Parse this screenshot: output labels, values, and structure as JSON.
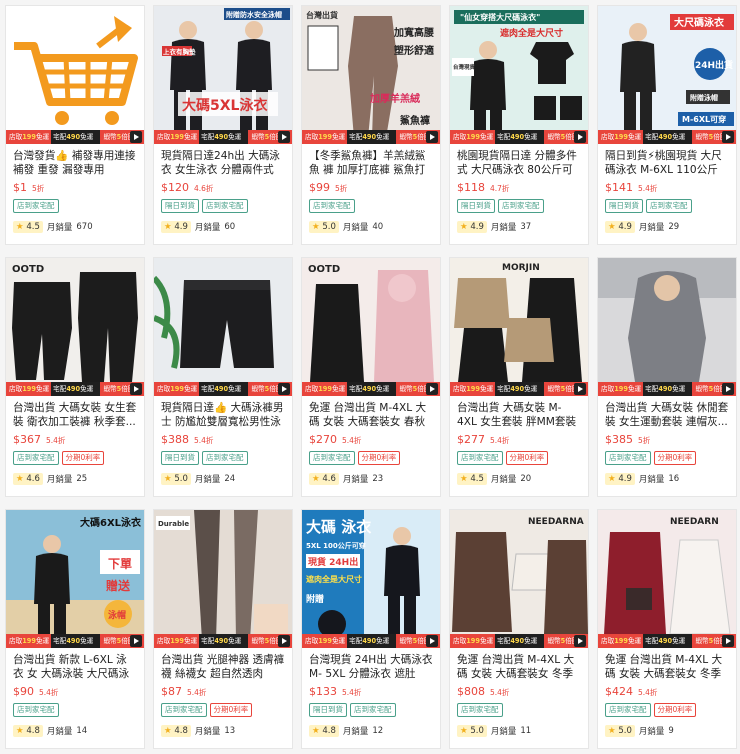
{
  "promo": {
    "pickup": "店取",
    "pickup_amt": "199",
    "ship": "免運",
    "home": "宅配",
    "home_amt": "490",
    "home_ship": "免運",
    "ad": "蝦幣",
    "back": "5",
    "back_unit": "倍回饋"
  },
  "products": [
    {
      "title": "台灣發貨👍 補發專用連接 補發 重發 漏發專用",
      "price": "$1",
      "disc": "5折",
      "tags": [
        "店到家宅配"
      ],
      "rating": "4.5",
      "sold_label": "月銷量",
      "sold": "670",
      "theme": "cart",
      "img_texts": []
    },
    {
      "title": "現貨隔日達24h出 大碼泳衣 女生泳衣 分體兩件式 泳...",
      "price": "$120",
      "disc": "4.6折",
      "tags": [
        "隔日到貨",
        "店到家宅配"
      ],
      "rating": "4.9",
      "sold_label": "月銷量",
      "sold": "60",
      "theme": "swim",
      "img_texts": [
        "附贈防水安全泳帽",
        "上衣有胸墊",
        "大碼5XL泳衣"
      ]
    },
    {
      "title": "【冬季鯊魚褲】羊羔絨鯊魚 褲 加厚打底褲 鯊魚打底...",
      "price": "$99",
      "disc": "5折",
      "tags": [
        "店到家宅配"
      ],
      "rating": "5.0",
      "sold_label": "月銷量",
      "sold": "40",
      "theme": "legging",
      "img_texts": [
        "台灣出貨",
        "加寬高腰",
        "塑形舒適",
        "加厚羊羔絨",
        "鯊魚褲"
      ]
    },
    {
      "title": "桃園現貨隔日達 分體多件式 大尺碼泳衣 80公斤可穿...",
      "price": "$118",
      "disc": "4.7折",
      "tags": [
        "隔日到貨",
        "店到家宅配"
      ],
      "rating": "4.9",
      "sold_label": "月銷量",
      "sold": "37",
      "theme": "swim2",
      "img_texts": [
        "\"仙女穿搭大尺碼泳衣\"",
        "遮肉全是大尺寸",
        "台灣現貨"
      ]
    },
    {
      "title": "隔日到貨⚡桃園現貨 大尺 碼泳衣 M-6XL 110公斤可...",
      "price": "$141",
      "disc": "5.4折",
      "tags": [
        "隔日到貨",
        "店到家宅配"
      ],
      "rating": "4.9",
      "sold_label": "月銷量",
      "sold": "29",
      "theme": "swim3",
      "img_texts": [
        "大尺碼泳衣",
        "24H出貨",
        "附贈泳帽",
        "M-6XL可穿"
      ]
    },
    {
      "title": "台灣出貨 大碼女裝 女生套 裝 衛衣加工裝褲 秋季套...",
      "price": "$367",
      "disc": "5.4折",
      "tags": [
        "店到家宅配",
        "分期0利率"
      ],
      "rating": "4.6",
      "sold_label": "月銷量",
      "sold": "25",
      "theme": "black2",
      "img_texts": [
        "OOTD"
      ]
    },
    {
      "title": "現貨隔日達👍 大碼泳褲男士 防尷尬雙層寬松男性泳褲 ...",
      "price": "$388",
      "disc": "5.4折",
      "tags": [
        "隔日到貨",
        "店到家宅配"
      ],
      "rating": "5.0",
      "sold_label": "月銷量",
      "sold": "24",
      "theme": "shorts",
      "img_texts": []
    },
    {
      "title": "免運 台灣出貨 M-4XL 大碼 女裝 大碼套裝女 春秋季...",
      "price": "$270",
      "disc": "5.4折",
      "tags": [
        "店到家宅配",
        "分期0利率"
      ],
      "rating": "4.6",
      "sold_label": "月銷量",
      "sold": "23",
      "theme": "pink",
      "img_texts": [
        "OOTD"
      ]
    },
    {
      "title": "台灣出貨 大碼女裝 M-4XL 女生套裝 胖MM套裝 大碼...",
      "price": "$277",
      "disc": "5.4折",
      "tags": [
        "店到家宅配",
        "分期0利率"
      ],
      "rating": "4.5",
      "sold_label": "月銷量",
      "sold": "20",
      "theme": "beige",
      "img_texts": [
        "MORJIN"
      ]
    },
    {
      "title": "台灣出貨 大碼女裝 休閒套 裝 女生運動套裝 連帽灰...",
      "price": "$385",
      "disc": "5折",
      "tags": [
        "店到家宅配",
        "分期0利率"
      ],
      "rating": "4.9",
      "sold_label": "月銷量",
      "sold": "16",
      "theme": "gray",
      "img_texts": []
    },
    {
      "title": "台灣出貨 新款 L-6XL 泳衣 女 大碼泳裝 大尺碼泳衣 ...",
      "price": "$90",
      "disc": "5.4折",
      "tags": [
        "店到家宅配"
      ],
      "rating": "4.8",
      "sold_label": "月銷量",
      "sold": "14",
      "theme": "beach",
      "img_texts": [
        "大碼6XL泳衣",
        "下單",
        "贈送",
        "泳帽"
      ]
    },
    {
      "title": "台灣出貨 光腿神器 透膚褲 襪 絲襪女 超自然透肉 秋...",
      "price": "$87",
      "disc": "5.4折",
      "tags": [
        "店到家宅配",
        "分期0利率"
      ],
      "rating": "4.8",
      "sold_label": "月銷量",
      "sold": "13",
      "theme": "tights",
      "img_texts": [
        "Durable"
      ]
    },
    {
      "title": "台灣現貨 24H出 大碼泳衣 M- 5XL 分體泳衣 遮肚泳...",
      "price": "$133",
      "disc": "5.4折",
      "tags": [
        "隔日到貨",
        "店到家宅配"
      ],
      "rating": "4.8",
      "sold_label": "月銷量",
      "sold": "12",
      "theme": "blue",
      "img_texts": [
        "大碼 泳衣",
        "5XL 100公斤可穿",
        "現貨 24H出",
        "遮肉全是大尺寸",
        "附贈"
      ]
    },
    {
      "title": "免運 台灣出貨 M-4XL 大碼 女裝 大碼套裝女 冬季套...",
      "price": "$808",
      "disc": "5.4折",
      "tags": [
        "店到家宅配"
      ],
      "rating": "5.0",
      "sold_label": "月銷量",
      "sold": "11",
      "theme": "brown",
      "img_texts": [
        "NEEDARNA"
      ]
    },
    {
      "title": "免運 台灣出貨 M-4XL 大碼 女裝 大碼套裝女 冬季套...",
      "price": "$424",
      "disc": "5.4折",
      "tags": [
        "店到家宅配",
        "分期0利率"
      ],
      "rating": "5.0",
      "sold_label": "月銷量",
      "sold": "9",
      "theme": "red",
      "img_texts": [
        "NEEDARN"
      ]
    }
  ],
  "colors": {
    "accent": "#e8453c",
    "tag": "#4aa08a",
    "cart": "#f39a1e"
  }
}
